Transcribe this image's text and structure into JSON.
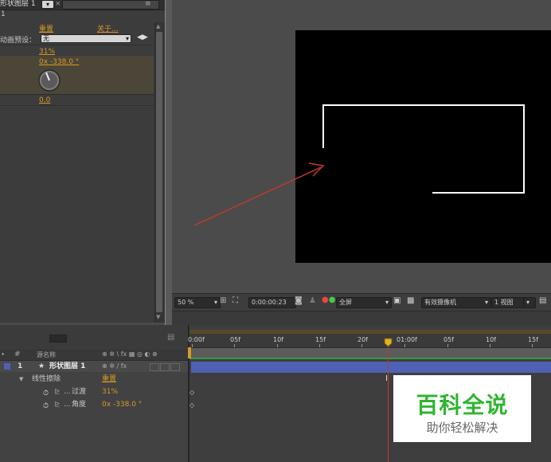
{
  "effects_panel": {
    "tab_label": "形状图层 1",
    "row_index": "1",
    "reset_label": "重置",
    "about_label": "关于...",
    "preset_label": "动画预设：",
    "preset_value": "无",
    "transition_value": "31%",
    "angle_value": "0x -338.0 °",
    "feather_value": "0.0"
  },
  "viewer_toolbar": {
    "zoom": "50 %",
    "timecode": "0:00:00:23",
    "resolution": "全屏",
    "camera": "有效摄像机",
    "views": "1 视图"
  },
  "timeline": {
    "header_source": "源名称",
    "header_switches": "⊕ ✲ \\ fx ▦ ◎ ◐ ⊕",
    "layer_number": "1",
    "layer_name": "形状图层 1",
    "effect_name": "线性擦除",
    "effect_reset": "重置",
    "prop1_name": "过渡",
    "prop1_value": "31%",
    "prop2_name": "角度",
    "prop2_value": "0x -338.0 °",
    "ruler": [
      "0:00f",
      "05f",
      "10f",
      "15f",
      "20f",
      "01:00f",
      "05f",
      "10f",
      "15f"
    ]
  },
  "watermark": {
    "title": "百科全说",
    "subtitle": "助你轻松解决"
  },
  "colors": {
    "accent": "#d89a22",
    "layer_bar": "#4f61b4",
    "playhead": "#c0392b",
    "watermark_green": "#2fb52f"
  }
}
